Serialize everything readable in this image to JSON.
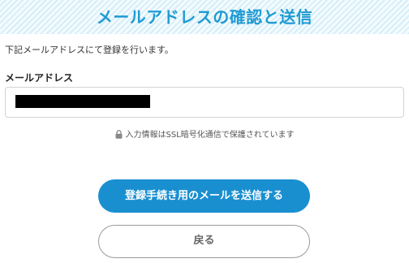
{
  "header": {
    "title": "メールアドレスの確認と送信"
  },
  "intro_text": "下記メールアドレスにて登録を行います。",
  "email_field": {
    "label": "メールアドレス"
  },
  "ssl_note": {
    "icon": "lock-icon",
    "text": "入力情報はSSL暗号化通信で保護されています"
  },
  "buttons": {
    "submit_label": "登録手続き用のメールを送信する",
    "back_label": "戻る"
  },
  "colors": {
    "accent": "#1f9bd3",
    "primary_button": "#1a8fd0",
    "header_stripe": "#d6eef8"
  }
}
